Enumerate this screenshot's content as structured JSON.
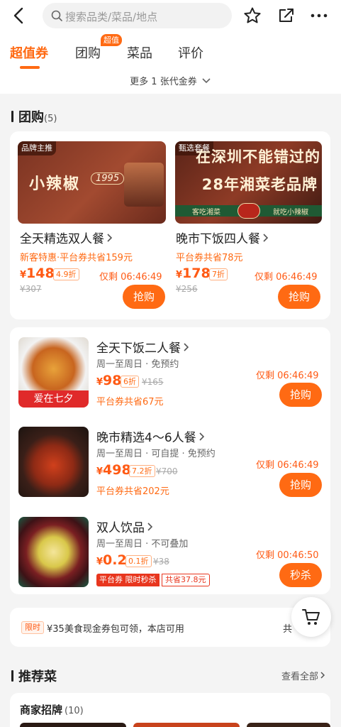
{
  "header": {
    "search_placeholder": "搜索品类/菜品/地点"
  },
  "tabs": [
    {
      "label": "超值券"
    },
    {
      "label": "团购"
    },
    {
      "label": "菜品"
    },
    {
      "label": "评价"
    }
  ],
  "tab_badge": "超值",
  "more_coupons": "更多 1 张代金券",
  "group_section": {
    "title": "团购",
    "count": "(5)"
  },
  "featured": [
    {
      "tag": "品牌主推",
      "img_text": "小辣椒",
      "img_logo": "1995",
      "name": "全天精选双人餐",
      "promo": "新客特惠·平台券共省159元",
      "yen": "¥",
      "price": "148",
      "discount": "4.9折",
      "orig_price": "¥307",
      "remain": "仅剩 06:46:49",
      "button": "抢购"
    },
    {
      "tag": "甄选套餐",
      "img_text": "在深圳不能错过的",
      "img_text2": "28年湘菜老品牌",
      "img_sub1": "客吃湘菜",
      "img_sub2": "就吃小辣椒",
      "name": "晚市下饭四人餐",
      "promo": "平台券共省78元",
      "yen": "¥",
      "price": "178",
      "discount": "7折",
      "orig_price": "¥256",
      "remain": "仅剩 06:46:49",
      "button": "抢购"
    }
  ],
  "items": [
    {
      "name": "全天下饭二人餐",
      "desc": "周一至周日 · 免预约",
      "yen": "¥",
      "price": "98",
      "discount": "6折",
      "orig_price": "¥165",
      "save": "平台券共省67元",
      "remain": "仅剩 06:46:49",
      "button": "抢购",
      "thumb_caption": "爱在七夕"
    },
    {
      "name": "晚市精选4～6人餐",
      "desc": "周一至周日 · 可自提 · 免预约",
      "yen": "¥",
      "price": "498",
      "discount": "7.2折",
      "orig_price": "¥700",
      "save": "平台券共省202元",
      "remain": "仅剩 06:46:49",
      "button": "抢购"
    },
    {
      "name": "双人饮品",
      "desc": "周一至周日 · 不可叠加",
      "yen": "¥",
      "price": "0.2",
      "discount": "0.1折",
      "orig_price": "¥38",
      "tag_a": "平台券 限时秒杀",
      "tag_b": "共省37.8元",
      "remain": "仅剩 00:46:50",
      "button": "秒杀"
    }
  ],
  "coupon_bar": {
    "tag": "限时",
    "text": "¥35美食现金券包可领，本店可用",
    "right": "共"
  },
  "recommend": {
    "title": "推荐菜",
    "see_all": "查看全部",
    "signature": "商家招牌",
    "signature_count": "(10)"
  },
  "colors": {
    "accent": "#ff6a13",
    "price": "#ff5a14"
  }
}
